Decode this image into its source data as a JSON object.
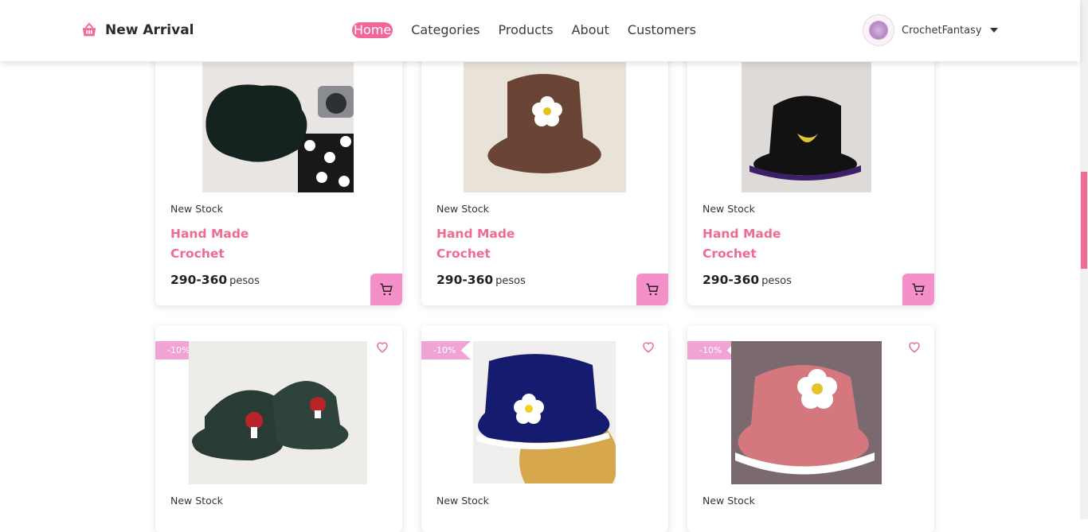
{
  "header": {
    "brand": "New Arrival",
    "nav": [
      "Home",
      "Categories",
      "Products",
      "About",
      "Customers"
    ],
    "user": "CrochetFantasy"
  },
  "colors": {
    "accent": "#f06b8f",
    "nav_active": "#f3669a",
    "ribbon": "#f0a4d5",
    "cart": "#f48fc9"
  },
  "products": [
    {
      "stock": "New Stock",
      "name_line1": "Hand Made",
      "name_line2": "Crochet",
      "price": "290-360",
      "unit": "pesos"
    },
    {
      "stock": "New Stock",
      "name_line1": "Hand Made",
      "name_line2": "Crochet",
      "price": "290-360",
      "unit": "pesos"
    },
    {
      "stock": "New Stock",
      "name_line1": "Hand Made",
      "name_line2": "Crochet",
      "price": "290-360",
      "unit": "pesos"
    },
    {
      "stock": "New Stock",
      "discount": "-10%"
    },
    {
      "stock": "New Stock",
      "discount": "-10%"
    },
    {
      "stock": "New Stock",
      "discount": "-10%"
    }
  ]
}
